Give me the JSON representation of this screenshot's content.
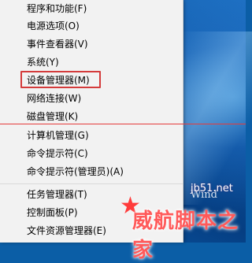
{
  "menu": {
    "items": [
      {
        "label": "程序和功能(F)"
      },
      {
        "label": "电源选项(O)"
      },
      {
        "label": "事件查看器(V)"
      },
      {
        "label": "系统(Y)"
      },
      {
        "label": "设备管理器(M)"
      },
      {
        "label": "网络连接(W)"
      },
      {
        "label": "磁盘管理(K)"
      },
      {
        "label": "计算机管理(G)"
      },
      {
        "label": "命令提示符(C)"
      },
      {
        "label": "命令提示符(管理员)(A)"
      },
      {
        "label": "任务管理器(T)"
      },
      {
        "label": "控制面板(P)"
      },
      {
        "label": "文件资源管理器(E)"
      }
    ]
  },
  "desktop": {
    "partial_text": "Wind"
  },
  "watermark": {
    "url": "jb51.net",
    "text": "威航脚本之家"
  },
  "colors": {
    "highlight_border": "#d43b3b",
    "menu_bg": "#f2f2f2"
  }
}
